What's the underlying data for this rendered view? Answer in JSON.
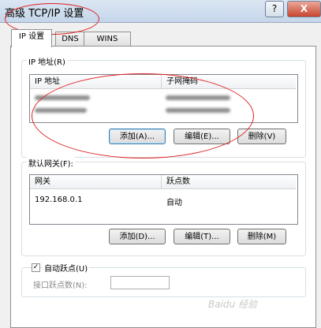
{
  "window": {
    "title": "高级 TCP/IP 设置",
    "help_label": "?",
    "close_label": "X"
  },
  "tabs": [
    "IP 设置",
    "DNS",
    "WINS"
  ],
  "ip_section": {
    "label": "IP 地址(R)",
    "columns": [
      "IP 地址",
      "子网掩码"
    ],
    "buttons": {
      "add": "添加(A)...",
      "edit": "编辑(E)...",
      "delete": "删除(V)"
    }
  },
  "gateway_section": {
    "label": "默认网关(F):",
    "columns": [
      "网关",
      "跃点数"
    ],
    "rows": [
      {
        "gateway": "192.168.0.1",
        "metric": "自动"
      }
    ],
    "buttons": {
      "add": "添加(D)...",
      "edit": "编辑(T)...",
      "delete": "删除(M)"
    }
  },
  "auto_metric": {
    "label": "自动跃点(U)",
    "checked": "✓"
  },
  "interface_metric": {
    "label": "接口跃点数(N):",
    "value": ""
  },
  "watermark": "Baidu 经验",
  "colors": {
    "annotation": "#e02020",
    "titlebar": "#c5d6ea"
  }
}
